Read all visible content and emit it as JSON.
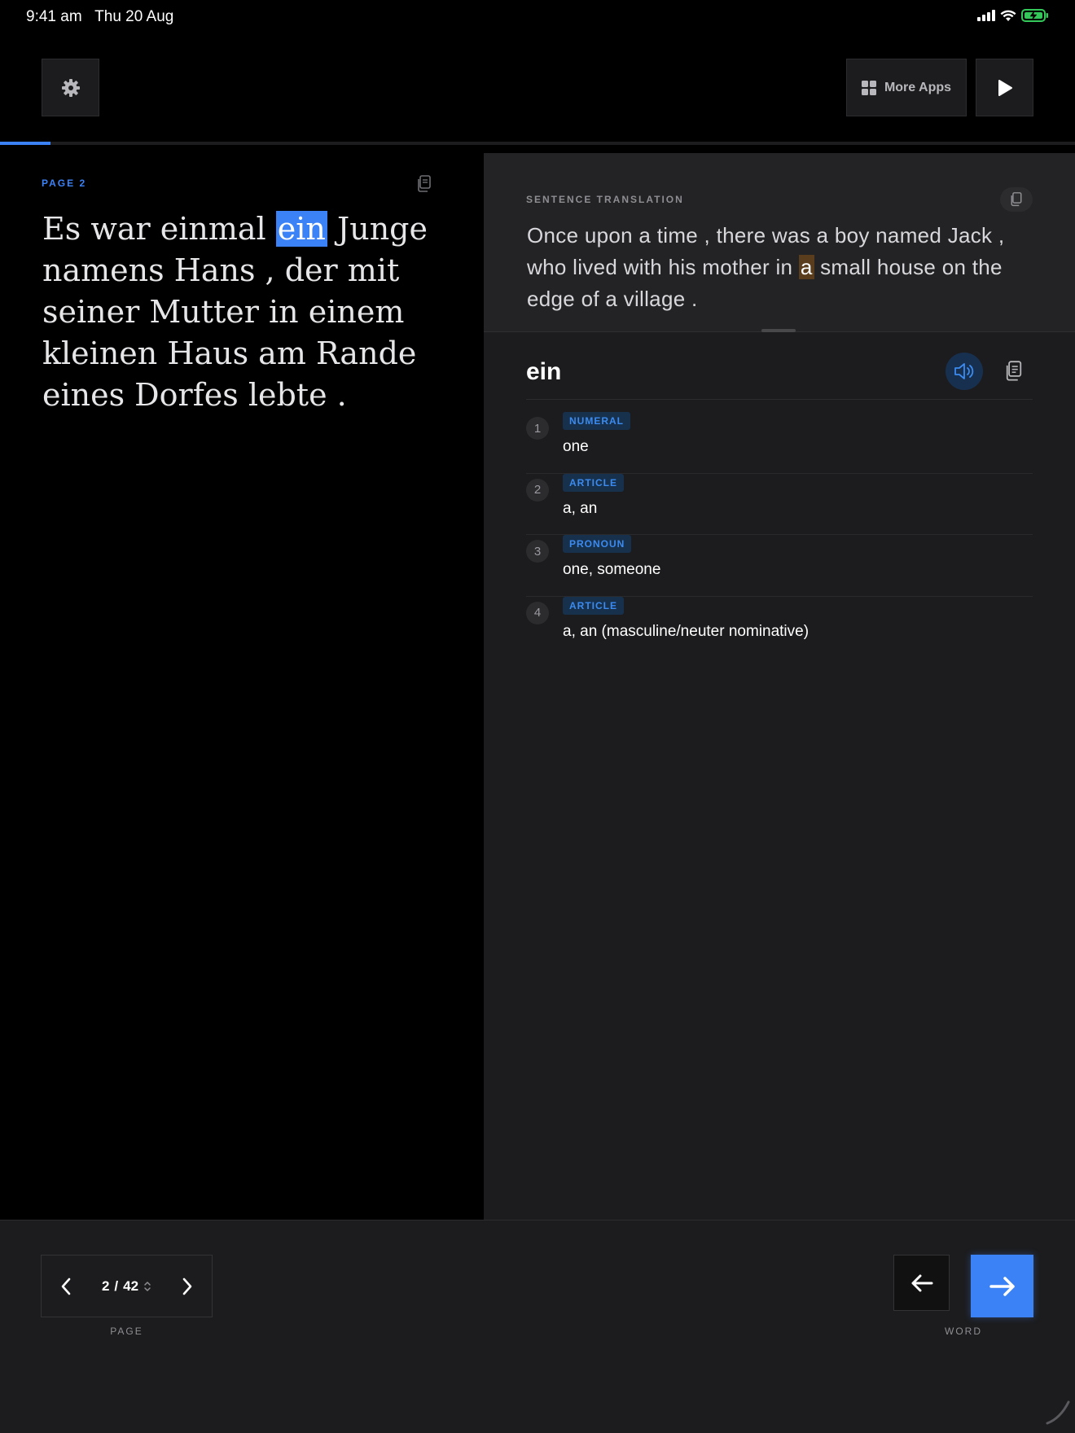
{
  "status_bar": {
    "time": "9:41 am",
    "date": "Thu 20 Aug",
    "icons": [
      "signal-icon",
      "wifi-icon",
      "battery-charging-icon"
    ]
  },
  "toolbar": {
    "settings_icon": "gear-icon",
    "more_apps_label": "More Apps",
    "more_apps_icon": "grid-icon",
    "play_icon": "play-icon"
  },
  "progress": {
    "fraction": 0.047,
    "color": "#3b82f6"
  },
  "source": {
    "page_label": "PAGE  2",
    "sentence_before": "Es war einmal ",
    "highlight_word": "ein",
    "sentence_after": " Junge namens Hans , der mit seiner Mutter in einem kleinen Haus am Rande eines Dorfes lebte .",
    "copy_icon": "copy-icon"
  },
  "translation": {
    "label": "SENTENCE TRANSLATION",
    "text_before": "Once upon a time , there was a boy named Jack , who lived with his mother in ",
    "highlight_word": "a",
    "text_after": " small house on the edge of a village .",
    "copy_icon": "copy-icon"
  },
  "word": {
    "title": "ein",
    "speaker_icon": "speaker-icon",
    "copy_icon": "copy-icon",
    "definitions": [
      {
        "num": "1",
        "pos": "NUMERAL",
        "meaning": "one"
      },
      {
        "num": "2",
        "pos": "ARTICLE",
        "meaning": "a, an"
      },
      {
        "num": "3",
        "pos": "PRONOUN",
        "meaning": "one, someone"
      },
      {
        "num": "4",
        "pos": "ARTICLE",
        "meaning": "a, an (masculine/neuter nominative)"
      }
    ]
  },
  "bottom": {
    "page_current": "2",
    "page_separator": "/",
    "page_total": "42",
    "page_label": "PAGE",
    "word_label": "WORD",
    "accent": "#3b82f6"
  }
}
